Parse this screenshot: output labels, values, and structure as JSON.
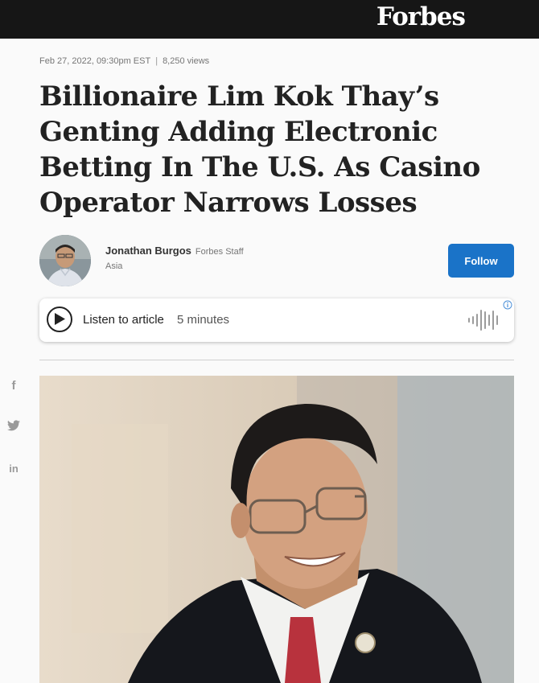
{
  "header": {
    "brand": "Forbes"
  },
  "article": {
    "date": "Feb 27, 2022, 09:30pm EST",
    "separator": "|",
    "views": "8,250 views",
    "headline": "Billionaire Lim Kok Thay’s Genting Adding Electronic Betting In The U.S. As Casino Operator Narrows Losses"
  },
  "author": {
    "name": "Jonathan Burgos",
    "role": "Forbes Staff",
    "section": "Asia",
    "follow_label": "Follow"
  },
  "listen": {
    "label": "Listen to article",
    "duration": "5 minutes"
  },
  "share": {
    "icons": [
      "facebook-icon",
      "twitter-icon",
      "linkedin-icon"
    ],
    "facebook_glyph": "f",
    "linkedin_glyph": "in"
  },
  "colors": {
    "topbar": "#161616",
    "follow_button": "#1a73c8",
    "headline": "#222222"
  }
}
